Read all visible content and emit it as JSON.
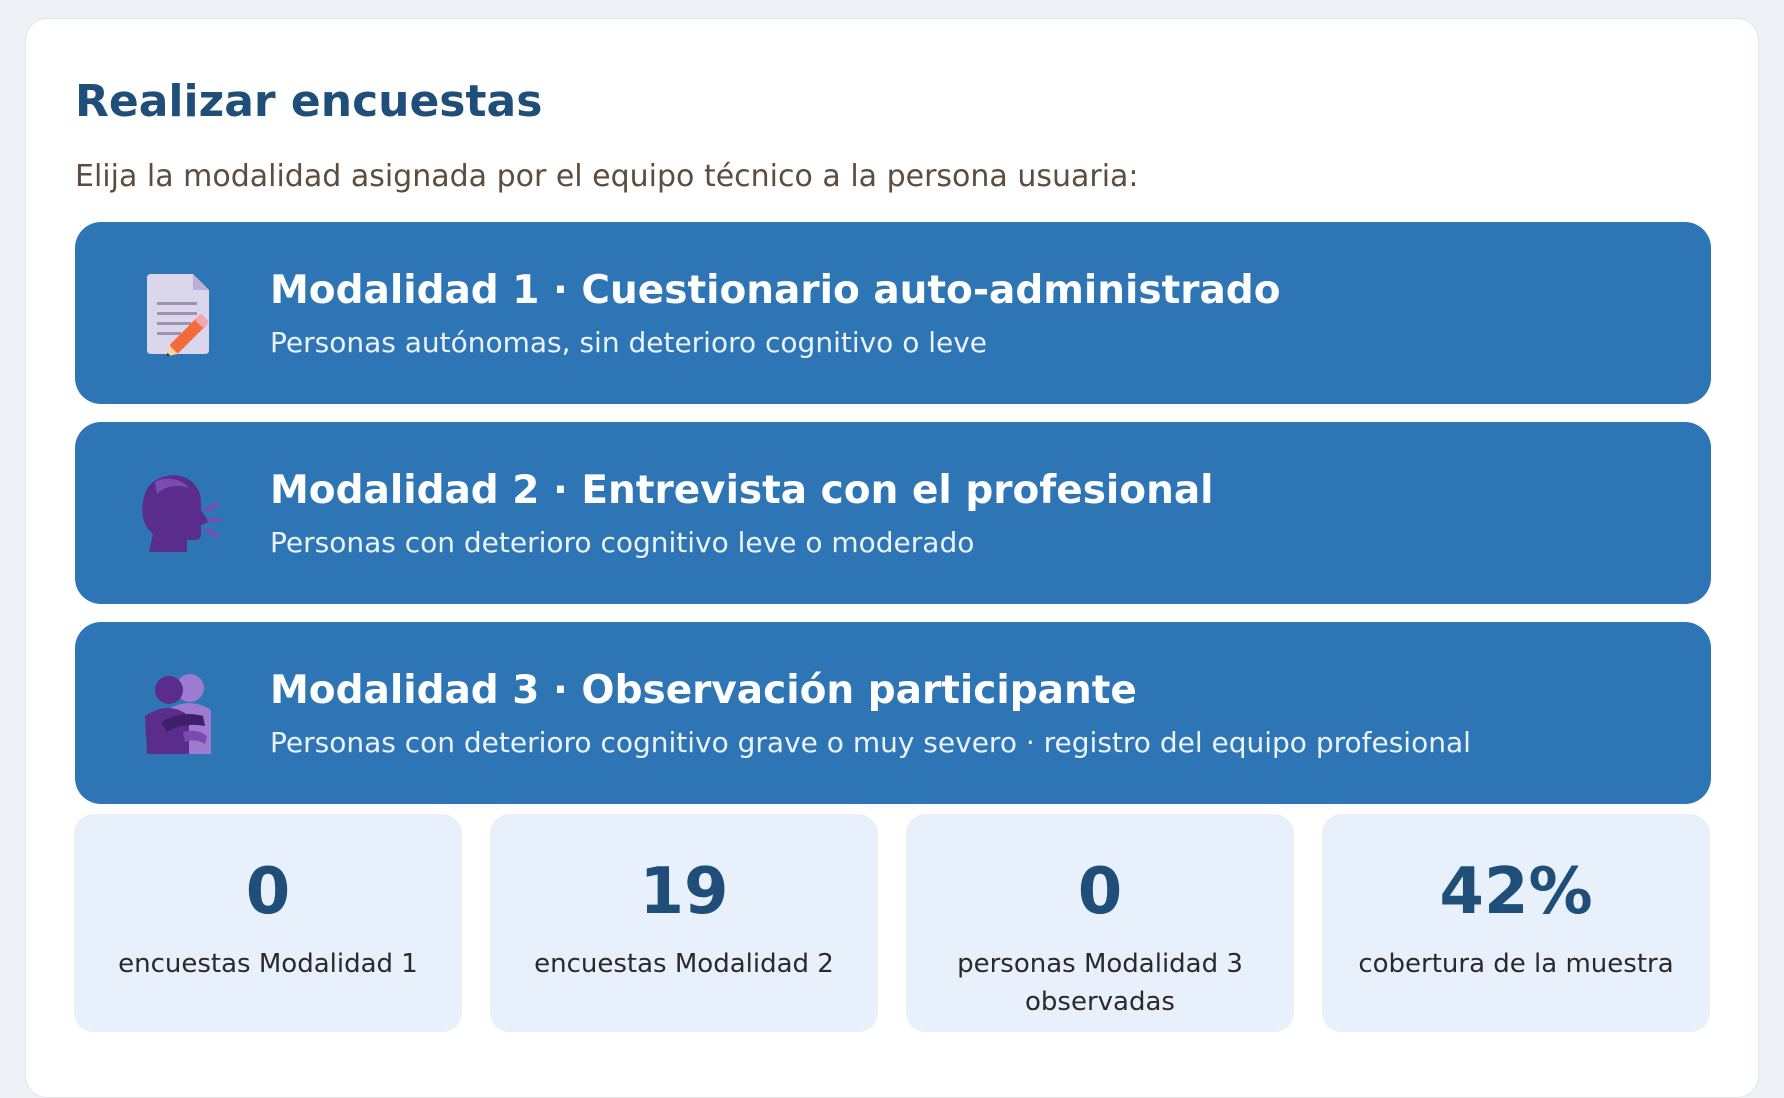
{
  "page": {
    "title": "Realizar encuestas",
    "subtitle": "Elija la modalidad asignada por el equipo técnico a la persona usuaria:"
  },
  "modes": [
    {
      "title": "Modalidad 1 · Cuestionario auto-administrado",
      "description": "Personas autónomas, sin deterioro cognitivo o leve",
      "icon": "memo-pencil-icon"
    },
    {
      "title": "Modalidad 2 · Entrevista con el profesional",
      "description": "Personas con deterioro cognitivo leve o moderado",
      "icon": "speaking-head-icon"
    },
    {
      "title": "Modalidad 3 · Observación participante",
      "description": "Personas con deterioro cognitivo grave o muy severo · registro del equipo profesional",
      "icon": "people-hugging-icon"
    }
  ],
  "stats": [
    {
      "value": "0",
      "label": "encuestas Modalidad 1"
    },
    {
      "value": "19",
      "label": "encuestas Modalidad 2"
    },
    {
      "value": "0",
      "label": "personas Modalidad 3 observadas"
    },
    {
      "value": "42%",
      "label": "cobertura de la muestra"
    }
  ],
  "colors": {
    "accent": "#2e75b6",
    "title": "#1f4e79",
    "stat_background": "#e8f1fb",
    "page_background": "#eef2f6"
  }
}
